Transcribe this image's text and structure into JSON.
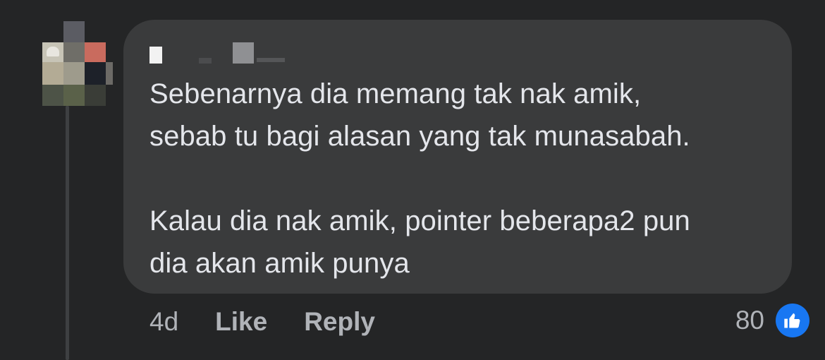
{
  "comment": {
    "text_line_1": "Sebenarnya dia memang tak nak amik,",
    "text_line_2": "sebab tu bagi alasan yang tak munasabah.",
    "text_line_3": "Kalau dia nak amik, pointer beberapa2 pun",
    "text_line_4": "dia akan amik punya"
  },
  "actions": {
    "time": "4d",
    "like_label": "Like",
    "reply_label": "Reply"
  },
  "reactions": {
    "count": "80",
    "icon": "thumbs-up-icon",
    "badge_color": "#1877f2"
  },
  "colors": {
    "background": "#242526",
    "bubble": "#3a3b3c",
    "text": "#e4e6eb",
    "secondary_text": "#b0b3b8"
  }
}
